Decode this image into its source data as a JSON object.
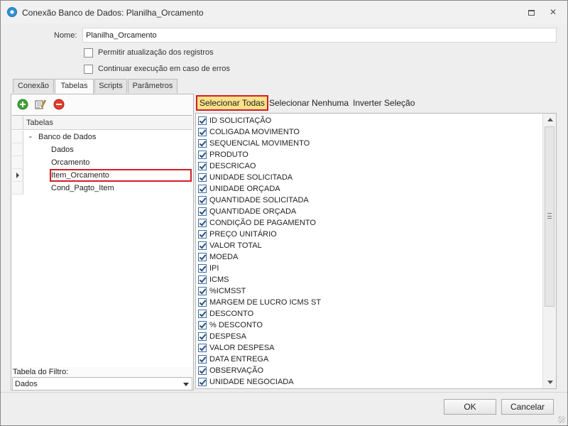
{
  "window": {
    "title": "Conexão Banco de Dados: Planilha_Orcamento",
    "restore_icon": "restore-icon",
    "close_symbol": "✕"
  },
  "form": {
    "name_label": "Nome:",
    "name_value": "Planilha_Orcamento",
    "allow_update_label": "Permitir atualização dos registros",
    "allow_update_checked": false,
    "continue_on_error_label": "Continuar execução em caso de erros",
    "continue_on_error_checked": false
  },
  "tabs": [
    {
      "label": "Conexão",
      "active": false
    },
    {
      "label": "Tabelas",
      "active": true
    },
    {
      "label": "Scripts",
      "active": false
    },
    {
      "label": "Parâmetros",
      "active": false
    }
  ],
  "toolbar": {
    "icons": [
      "add-icon",
      "edit-icon",
      "remove-icon"
    ]
  },
  "tree": {
    "header": "Tabelas",
    "root": "Banco de Dados",
    "expander": "⌄",
    "children": [
      "Dados",
      "Orcamento",
      "Item_Orcamento",
      "Cond_Pagto_Item"
    ],
    "selected": "Item_Orcamento"
  },
  "filter": {
    "label": "Tabela do Filtro:",
    "selected": "Dados"
  },
  "selection_actions": {
    "select_all": "Selecionar Todas",
    "select_none": "Selecionar Nenhuma",
    "invert": "Inverter Seleção"
  },
  "fields": [
    {
      "label": "ID SOLICITAÇÃO",
      "checked": true
    },
    {
      "label": "COLIGADA MOVIMENTO",
      "checked": true
    },
    {
      "label": "SEQUENCIAL MOVIMENTO",
      "checked": true
    },
    {
      "label": "PRODUTO",
      "checked": true
    },
    {
      "label": "DESCRICAO",
      "checked": true
    },
    {
      "label": "UNIDADE SOLICITADA",
      "checked": true
    },
    {
      "label": "UNIDADE ORÇADA",
      "checked": true
    },
    {
      "label": "QUANTIDADE SOLICITADA",
      "checked": true
    },
    {
      "label": "QUANTIDADE ORÇADA",
      "checked": true
    },
    {
      "label": "CONDIÇÃO DE PAGAMENTO",
      "checked": true
    },
    {
      "label": "PREÇO UNITÁRIO",
      "checked": true
    },
    {
      "label": "VALOR TOTAL",
      "checked": true
    },
    {
      "label": "MOEDA",
      "checked": true
    },
    {
      "label": "IPI",
      "checked": true
    },
    {
      "label": "ICMS",
      "checked": true
    },
    {
      "label": "%ICMSST",
      "checked": true
    },
    {
      "label": "MARGEM DE LUCRO ICMS ST",
      "checked": true
    },
    {
      "label": "DESCONTO",
      "checked": true
    },
    {
      "label": "% DESCONTO",
      "checked": true
    },
    {
      "label": "DESPESA",
      "checked": true
    },
    {
      "label": "VALOR DESPESA",
      "checked": true
    },
    {
      "label": "DATA ENTREGA",
      "checked": true
    },
    {
      "label": "OBSERVAÇÃO",
      "checked": true
    },
    {
      "label": "UNIDADE NEGOCIADA",
      "checked": true
    }
  ],
  "buttons": {
    "ok": "OK",
    "cancel": "Cancelar"
  },
  "colors": {
    "highlight_border": "#d21e26",
    "select_all_bg": "#fbe28a",
    "window_bg": "#eeeeee"
  }
}
